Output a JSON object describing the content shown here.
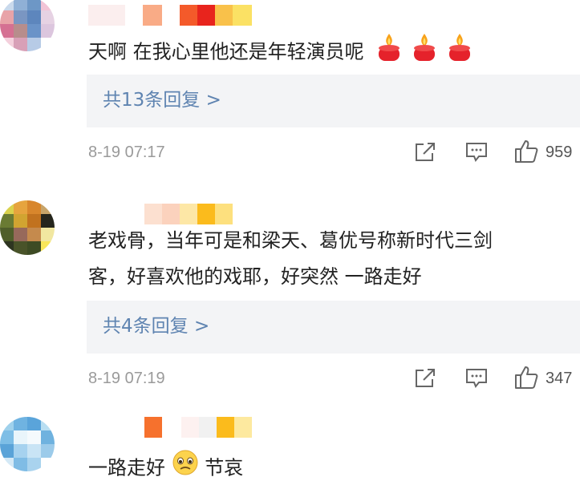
{
  "comments": [
    {
      "text": "天啊 在我心里他还是年轻演员呢",
      "replies": "共13条回复 >",
      "time": "8-19 07:17",
      "likes": "959",
      "emoji": "candle-icon"
    },
    {
      "text_line1": "老戏骨，当年可是和梁天、葛优号称新时代三剑",
      "text_line2": "客，好喜欢他的戏耶，好突然 一路走好",
      "replies": "共4条回复 >",
      "time": "8-19 07:19",
      "likes": "347"
    },
    {
      "text": "一路走好",
      "text_after": "节哀",
      "emoji": "crying-face-icon"
    }
  ],
  "icons": {
    "share": "share-icon",
    "comment": "comment-icon",
    "like": "thumbs-up-icon"
  },
  "colors": {
    "reply_link": "#5f84b1",
    "reply_bg": "#f3f4f6",
    "meta_text": "#9a9a9a"
  }
}
